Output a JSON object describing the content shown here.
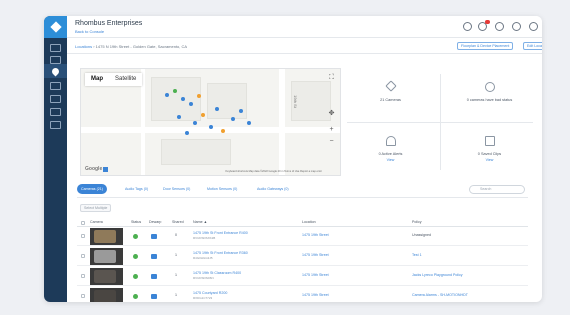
{
  "app": {
    "org_title": "Rhombus Enterprises",
    "org_link": "Back to Console"
  },
  "breadcrumb": {
    "root": "Locations",
    "path": " › 1475 N 19th Street - Golden Gate, Sacramento, CA"
  },
  "header_actions": {
    "floorplan": "Floorplan & Device Placement",
    "edit_location": "Edit Location"
  },
  "map": {
    "toggle_map": "Map",
    "toggle_satellite": "Satellite",
    "google": "Google",
    "attribution": "Keyboard shortcuts   Map data ©2022 Google   20 m   Terms of Use   Report a map error",
    "street_label": "19th St"
  },
  "stats": [
    {
      "label": "21 Cameras",
      "link": "",
      "icon": "diamond-icon"
    },
    {
      "label": "0 cameras have bad status",
      "link": "",
      "icon": "check-circle-icon"
    },
    {
      "label": "0 Active Alerts",
      "link": "View",
      "icon": "bell-icon"
    },
    {
      "label": "0 Saved Clips",
      "link": "View",
      "icon": "film-icon"
    }
  ],
  "tabs": [
    {
      "label": "Cameras (21)",
      "active": true
    },
    {
      "label": "Audio Tags (0)",
      "active": false
    },
    {
      "label": "Door Sensors (0)",
      "active": false
    },
    {
      "label": "Motion Sensors (0)",
      "active": false
    },
    {
      "label": "Audio Gateways (0)",
      "active": false
    }
  ],
  "search": {
    "placeholder": "Search"
  },
  "select_button": "Select Multiple",
  "table": {
    "headers": [
      "Camera",
      "Status",
      "Dewarp",
      "Shared",
      "Name ▲",
      "Location",
      "Policy"
    ],
    "rows": [
      {
        "shared": "0",
        "name": "1475 19th St Front Entrance R400",
        "serial": "RVUDSDSXK2B",
        "location": "1475 19th Street",
        "policy": "Unassigned",
        "policy_link": false,
        "thumb_color": "#8f7a5a"
      },
      {
        "shared": "1",
        "name": "1475 19th St Front Entrance R360",
        "serial": "R4G0HGG3J5",
        "location": "1475 19th Street",
        "policy": "Test 1",
        "policy_link": true,
        "thumb_color": "#9a9a9a"
      },
      {
        "shared": "1",
        "name": "1475 19th St Classroom R400",
        "serial": "RVUDSDSD6N",
        "location": "1475 19th Street",
        "policy": "Jacks Lyreco Playground Policy",
        "policy_link": true,
        "thumb_color": "#5a5550"
      },
      {
        "shared": "1",
        "name": "1475 Courtyard R200",
        "serial": "RXDG1C7723",
        "location": "1475 19th Street",
        "policy": "Camera Alarms - SH-MOTIONHDT",
        "policy_link": true,
        "thumb_color": "#4a4642"
      }
    ]
  },
  "colors": {
    "sidebar": "#1d3a59",
    "accent": "#3b84d6",
    "status_ok": "#4cb050"
  }
}
